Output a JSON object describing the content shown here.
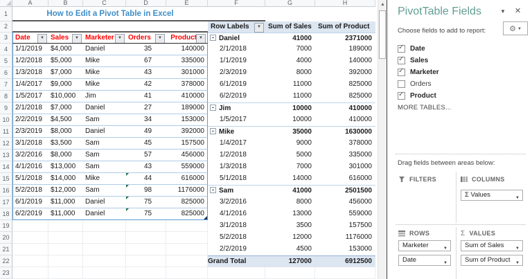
{
  "colors": {
    "title_blue": "#3E8EC9",
    "header_red": "#FF0000",
    "pivot_fill": "#DCE6F1",
    "table_line": "#AECBE8",
    "table_border": "#5B9BD5",
    "panel_title": "#619E92",
    "dark_line": "#595959"
  },
  "icons": {
    "scroll_up": "▲",
    "collapse": "▼",
    "close": "✕",
    "gear": "⚙",
    "dropdown": "▼",
    "check": "✓",
    "minus": "-"
  },
  "sheet": {
    "col_letters": [
      "A",
      "B",
      "C",
      "D",
      "E",
      "F",
      "G",
      "H"
    ],
    "row_numbers": [
      1,
      2,
      3,
      4,
      5,
      6,
      7,
      8,
      9,
      10,
      11,
      12,
      13,
      14,
      15,
      16,
      17,
      18,
      19,
      20,
      21,
      22,
      23
    ],
    "title": "How to Edit a Pivot Table in Excel",
    "table": {
      "headers": [
        "Date",
        "Sales",
        "Marketer",
        "Orders",
        "Product"
      ],
      "rows": [
        {
          "date": "1/1/2019",
          "sales": "$4,000",
          "marketer": "Daniel",
          "orders": "35",
          "product": "140000",
          "flagged": false
        },
        {
          "date": "1/2/2018",
          "sales": "$5,000",
          "marketer": "Mike",
          "orders": "67",
          "product": "335000",
          "flagged": false
        },
        {
          "date": "1/3/2018",
          "sales": "$7,000",
          "marketer": "Mike",
          "orders": "43",
          "product": "301000",
          "flagged": false
        },
        {
          "date": "1/4/2017",
          "sales": "$9,000",
          "marketer": "Mike",
          "orders": "42",
          "product": "378000",
          "flagged": false
        },
        {
          "date": "1/5/2017",
          "sales": "$10,000",
          "marketer": "Jim",
          "orders": "41",
          "product": "410000",
          "flagged": false
        },
        {
          "date": "2/1/2018",
          "sales": "$7,000",
          "marketer": "Daniel",
          "orders": "27",
          "product": "189000",
          "flagged": false
        },
        {
          "date": "2/2/2019",
          "sales": "$4,500",
          "marketer": "Sam",
          "orders": "34",
          "product": "153000",
          "flagged": false
        },
        {
          "date": "2/3/2019",
          "sales": "$8,000",
          "marketer": "Daniel",
          "orders": "49",
          "product": "392000",
          "flagged": false
        },
        {
          "date": "3/1/2018",
          "sales": "$3,500",
          "marketer": "Sam",
          "orders": "45",
          "product": "157500",
          "flagged": false
        },
        {
          "date": "3/2/2016",
          "sales": "$8,000",
          "marketer": "Sam",
          "orders": "57",
          "product": "456000",
          "flagged": false
        },
        {
          "date": "4/1/2016",
          "sales": "$13,000",
          "marketer": "Sam",
          "orders": "43",
          "product": "559000",
          "flagged": false
        },
        {
          "date": "5/1/2018",
          "sales": "$14,000",
          "marketer": "Mike",
          "orders": "44",
          "product": "616000",
          "flagged": true
        },
        {
          "date": "5/2/2018",
          "sales": "$12,000",
          "marketer": "Sam",
          "orders": "98",
          "product": "1176000",
          "flagged": true
        },
        {
          "date": "6/1/2019",
          "sales": "$11,000",
          "marketer": "Daniel",
          "orders": "75",
          "product": "825000",
          "flagged": true
        },
        {
          "date": "6/2/2019",
          "sales": "$11,000",
          "marketer": "Daniel",
          "orders": "75",
          "product": "825000",
          "flagged": true
        }
      ]
    }
  },
  "pivot": {
    "headers": [
      "Row Labels",
      "Sum of Sales",
      "Sum of Product"
    ],
    "rows": [
      {
        "type": "group",
        "label": "Daniel",
        "sales": "41000",
        "product": "2371000"
      },
      {
        "type": "detail",
        "label": "2/1/2018",
        "sales": "7000",
        "product": "189000"
      },
      {
        "type": "detail",
        "label": "1/1/2019",
        "sales": "4000",
        "product": "140000"
      },
      {
        "type": "detail",
        "label": "2/3/2019",
        "sales": "8000",
        "product": "392000"
      },
      {
        "type": "detail",
        "label": "6/1/2019",
        "sales": "11000",
        "product": "825000"
      },
      {
        "type": "detail",
        "label": "6/2/2019",
        "sales": "11000",
        "product": "825000"
      },
      {
        "type": "group",
        "label": "Jim",
        "sales": "10000",
        "product": "410000"
      },
      {
        "type": "detail",
        "label": "1/5/2017",
        "sales": "10000",
        "product": "410000"
      },
      {
        "type": "group",
        "label": "Mike",
        "sales": "35000",
        "product": "1630000"
      },
      {
        "type": "detail",
        "label": "1/4/2017",
        "sales": "9000",
        "product": "378000"
      },
      {
        "type": "detail",
        "label": "1/2/2018",
        "sales": "5000",
        "product": "335000"
      },
      {
        "type": "detail",
        "label": "1/3/2018",
        "sales": "7000",
        "product": "301000"
      },
      {
        "type": "detail",
        "label": "5/1/2018",
        "sales": "14000",
        "product": "616000"
      },
      {
        "type": "group",
        "label": "Sam",
        "sales": "41000",
        "product": "2501500"
      },
      {
        "type": "detail",
        "label": "3/2/2016",
        "sales": "8000",
        "product": "456000"
      },
      {
        "type": "detail",
        "label": "4/1/2016",
        "sales": "13000",
        "product": "559000"
      },
      {
        "type": "detail",
        "label": "3/1/2018",
        "sales": "3500",
        "product": "157500"
      },
      {
        "type": "detail",
        "label": "5/2/2018",
        "sales": "12000",
        "product": "1176000"
      },
      {
        "type": "detail",
        "label": "2/2/2019",
        "sales": "4500",
        "product": "153000"
      },
      {
        "type": "total",
        "label": "Grand Total",
        "sales": "127000",
        "product": "6912500"
      }
    ]
  },
  "panel": {
    "title": "PivotTable Fields",
    "choose_label": "Choose fields to add to report:",
    "fields": [
      {
        "label": "Date",
        "checked": true
      },
      {
        "label": "Sales",
        "checked": true
      },
      {
        "label": "Marketer",
        "checked": true
      },
      {
        "label": "Orders",
        "checked": false
      },
      {
        "label": "Product",
        "checked": true
      }
    ],
    "more_tables": "MORE TABLES...",
    "drag_label": "Drag fields between areas below:",
    "areas": {
      "filters": {
        "title": "FILTERS",
        "items": []
      },
      "columns": {
        "title": "COLUMNS",
        "items": [
          "Σ Values"
        ]
      },
      "rows": {
        "title": "ROWS",
        "items": [
          "Marketer",
          "Date"
        ]
      },
      "values": {
        "title": "VALUES",
        "items": [
          "Sum of Sales",
          "Sum of Product"
        ]
      }
    }
  }
}
